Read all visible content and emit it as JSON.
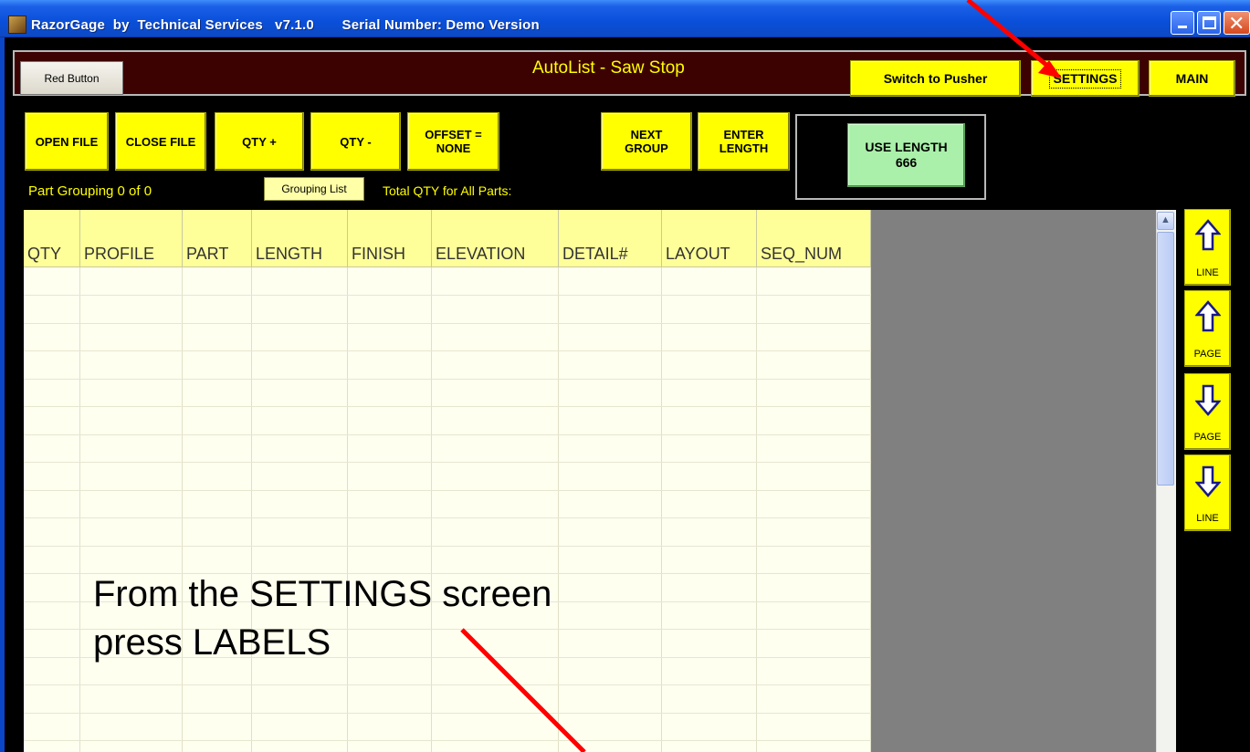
{
  "window": {
    "title": "RazorGage  by  Technical Services   v7.1.0       Serial Number: Demo Version",
    "controls": {
      "minimize": "minimize",
      "maximize": "maximize",
      "close": "✕"
    }
  },
  "header": {
    "title": "AutoList - Saw Stop",
    "red_button": "Red Button",
    "switch_pusher": "Switch to Pusher",
    "settings": "SETTINGS",
    "main": "MAIN"
  },
  "toolbar": {
    "open_file": "OPEN FILE",
    "close_file": "CLOSE FILE",
    "qty_plus": "QTY +",
    "qty_minus": "QTY -",
    "offset": "OFFSET =\nNONE",
    "next_group": "NEXT\nGROUP",
    "enter_length": "ENTER\nLENGTH",
    "use_length_label": "USE LENGTH",
    "use_length_value": "666"
  },
  "status": {
    "part_grouping": "Part Grouping 0 of 0",
    "grouping_list": "Grouping List",
    "total_qty": "Total QTY for All Parts:"
  },
  "grid": {
    "columns": [
      "QTY",
      "PROFILE",
      "PART",
      "LENGTH",
      "FINISH",
      "ELEVATION",
      "DETAIL#",
      "LAYOUT",
      "SEQ_NUM"
    ],
    "rows": []
  },
  "side_nav": {
    "line_up": "LINE",
    "page_up": "PAGE",
    "page_down": "PAGE",
    "line_down": "LINE"
  },
  "annotation": {
    "text": "From the SETTINGS screen\npress LABELS",
    "arrow_color": "#ff0000"
  },
  "colors": {
    "title_bar": "#0a4fd9",
    "header_bg": "#3c0202",
    "button_yellow": "#ffff00",
    "use_length_green": "#aaf0aa",
    "grid_header": "#ffff99"
  }
}
